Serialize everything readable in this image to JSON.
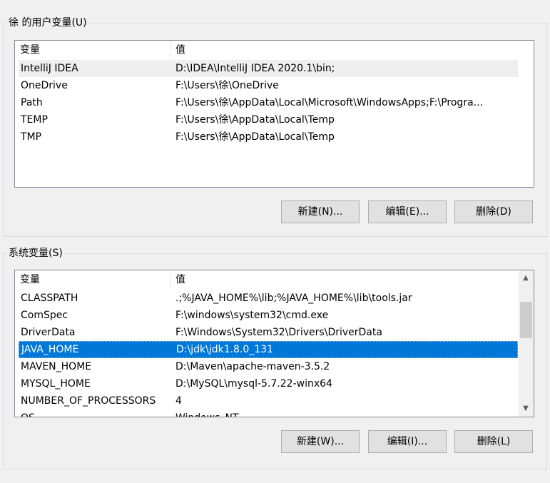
{
  "user_vars": {
    "title": "徐 的用户变量(U)",
    "columns": [
      "变量",
      "值"
    ],
    "rows": [
      {
        "name": "IntelliJ IDEA",
        "value": "D:\\IDEA\\IntelliJ IDEA 2020.1\\bin;"
      },
      {
        "name": "OneDrive",
        "value": "F:\\Users\\徐\\OneDrive"
      },
      {
        "name": "Path",
        "value": "F:\\Users\\徐\\AppData\\Local\\Microsoft\\WindowsApps;F:\\Progra..."
      },
      {
        "name": "TEMP",
        "value": "F:\\Users\\徐\\AppData\\Local\\Temp"
      },
      {
        "name": "TMP",
        "value": "F:\\Users\\徐\\AppData\\Local\\Temp"
      }
    ],
    "buttons": {
      "new": "新建(N)...",
      "edit": "编辑(E)...",
      "delete": "删除(D)"
    }
  },
  "system_vars": {
    "title": "系统变量(S)",
    "columns": [
      "变量",
      "值"
    ],
    "rows": [
      {
        "name": "CLASSPATH",
        "value": ".;%JAVA_HOME%\\lib;%JAVA_HOME%\\lib\\tools.jar"
      },
      {
        "name": "ComSpec",
        "value": "F:\\windows\\system32\\cmd.exe"
      },
      {
        "name": "DriverData",
        "value": "F:\\Windows\\System32\\Drivers\\DriverData"
      },
      {
        "name": "JAVA_HOME",
        "value": "D:\\jdk\\jdk1.8.0_131"
      },
      {
        "name": "MAVEN_HOME",
        "value": "D:\\Maven\\apache-maven-3.5.2"
      },
      {
        "name": "MYSQL_HOME",
        "value": "D:\\MySQL\\mysql-5.7.22-winx64"
      },
      {
        "name": "NUMBER_OF_PROCESSORS",
        "value": "4"
      },
      {
        "name": "OS",
        "value": "Windows_NT"
      }
    ],
    "buttons": {
      "new": "新建(W)...",
      "edit": "编辑(I)...",
      "delete": "删除(L)"
    }
  },
  "colors": {
    "selection": "#0078d7",
    "hover_row": "#efefef"
  },
  "icons": {
    "scroll_up": "▲",
    "scroll_down": "▼"
  }
}
